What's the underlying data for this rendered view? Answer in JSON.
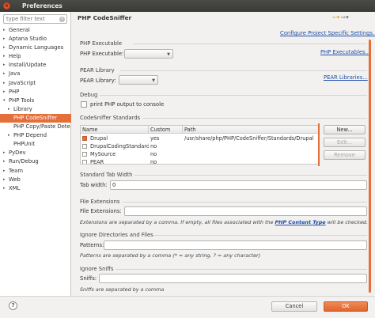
{
  "window": {
    "title": "Preferences"
  },
  "sidebar": {
    "filter_placeholder": "type filter text",
    "items": [
      {
        "label": "General",
        "arrow": "▸"
      },
      {
        "label": "Aptana Studio",
        "arrow": "▸"
      },
      {
        "label": "Dynamic Languages",
        "arrow": "▸"
      },
      {
        "label": "Help",
        "arrow": "▸"
      },
      {
        "label": "Install/Update",
        "arrow": "▸"
      },
      {
        "label": "Java",
        "arrow": "▸"
      },
      {
        "label": "JavaScript",
        "arrow": "▸"
      },
      {
        "label": "PHP",
        "arrow": "▸"
      },
      {
        "label": "PHP Tools",
        "arrow": "▾"
      },
      {
        "label": "Library",
        "arrow": "▸"
      },
      {
        "label": "PHP CodeSniffer",
        "arrow": ""
      },
      {
        "label": "PHP Copy/Paste Dete",
        "arrow": ""
      },
      {
        "label": "PHP Depend",
        "arrow": "▸"
      },
      {
        "label": "PHPUnit",
        "arrow": ""
      },
      {
        "label": "PyDev",
        "arrow": "▸"
      },
      {
        "label": "Run/Debug",
        "arrow": "▸"
      },
      {
        "label": "Team",
        "arrow": "▸"
      },
      {
        "label": "Web",
        "arrow": "▸"
      },
      {
        "label": "XML",
        "arrow": "▸"
      }
    ]
  },
  "header": {
    "title": "PHP CodeSniffer",
    "configure_link": "Configure Project Specific Settings..."
  },
  "php_executable": {
    "section": "PHP Executable",
    "label": "PHP Executable:",
    "link": "PHP Executables..."
  },
  "pear_library": {
    "section": "PEAR Library",
    "label": "PEAR Library:",
    "link": "PEAR Libraries..."
  },
  "debug": {
    "section": "Debug",
    "checkbox_label": "print PHP output to console"
  },
  "standards": {
    "section": "CodeSniffer Standards",
    "columns": [
      "Name",
      "Custom",
      "Path"
    ],
    "rows": [
      {
        "name": "Drupal",
        "custom": "yes",
        "path": "/usr/share/php/PHP/CodeSniffer/Standards/Drupal",
        "checked": true
      },
      {
        "name": "DrupalCodingStandard",
        "custom": "no",
        "path": "",
        "checked": false
      },
      {
        "name": "MySource",
        "custom": "no",
        "path": "",
        "checked": false
      },
      {
        "name": "PEAR",
        "custom": "no",
        "path": "",
        "checked": false
      }
    ],
    "buttons": {
      "new": "New...",
      "edit": "Edit...",
      "remove": "Remove"
    }
  },
  "tab_width": {
    "section": "Standard Tab Width",
    "label": "Tab width:",
    "value": "0"
  },
  "file_extensions": {
    "section": "File Extensions",
    "label": "File Extensions:",
    "hint_before": "Extensions are separated by a comma. If empty, all files associated with the ",
    "hint_link": "PHP Content Type",
    "hint_after": " will be checked."
  },
  "ignore_dirs": {
    "section": "Ignore Directories and Files",
    "label": "Patterns:",
    "hint": "Patterns are separated by a comma (* = any string, ? = any character)"
  },
  "ignore_sniffs": {
    "section": "Ignore Sniffs",
    "label": "Sniffs:",
    "hint": "Sniffs are separated by a comma"
  },
  "footer": {
    "help": "?",
    "cancel": "Cancel",
    "ok": "OK"
  },
  "colors": {
    "accent": "#e46f3a",
    "link": "#1d4ea8",
    "titlebar": "#3c3b37"
  }
}
